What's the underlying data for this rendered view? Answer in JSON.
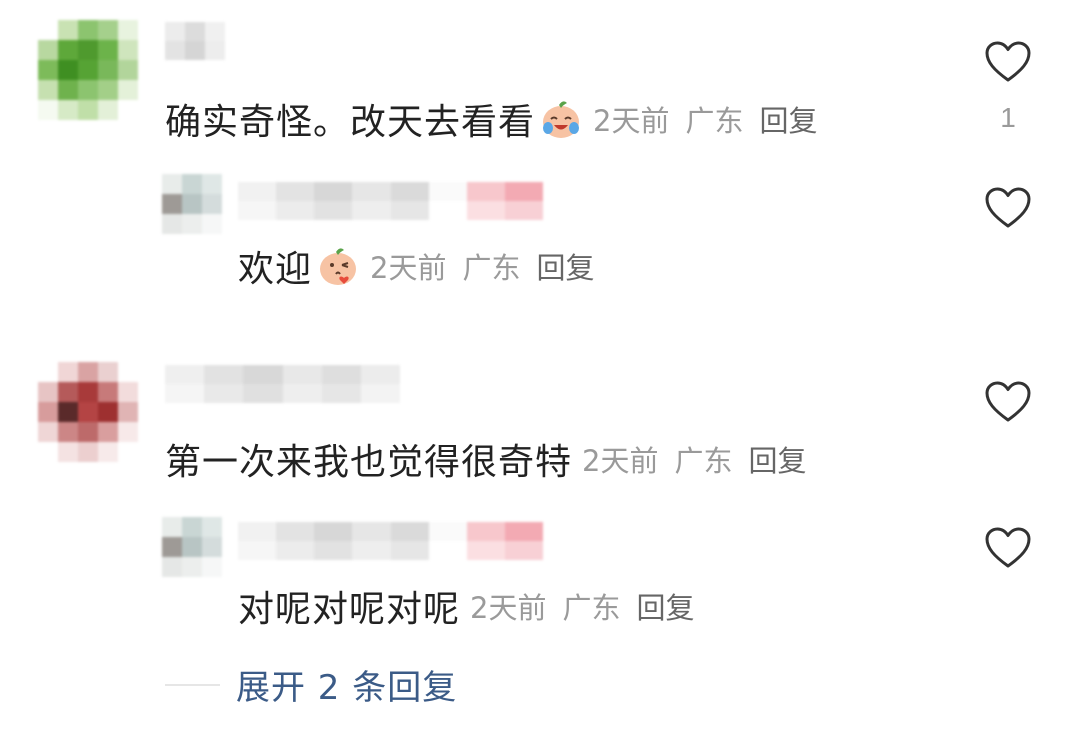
{
  "comments": [
    {
      "text": "确实奇怪。改天去看看",
      "emoji_icon": "laugh-cry-peach-emoji",
      "time": "2天前",
      "location": "广东",
      "reply_label": "回复",
      "like_count": "1",
      "replies": [
        {
          "text": "欢迎",
          "emoji_icon": "heart-kiss-peach-emoji",
          "time": "2天前",
          "location": "广东",
          "reply_label": "回复"
        }
      ]
    },
    {
      "text": "第一次来我也觉得很奇特",
      "time": "2天前",
      "location": "广东",
      "reply_label": "回复",
      "replies": [
        {
          "text": "对呢对呢对呢",
          "time": "2天前",
          "location": "广东",
          "reply_label": "回复"
        }
      ]
    }
  ],
  "expand_replies_label": "展开 2 条回复",
  "colors": {
    "text": "#222222",
    "meta": "#9a9a9a",
    "link": "#3b5b87",
    "heart": "#333333"
  }
}
